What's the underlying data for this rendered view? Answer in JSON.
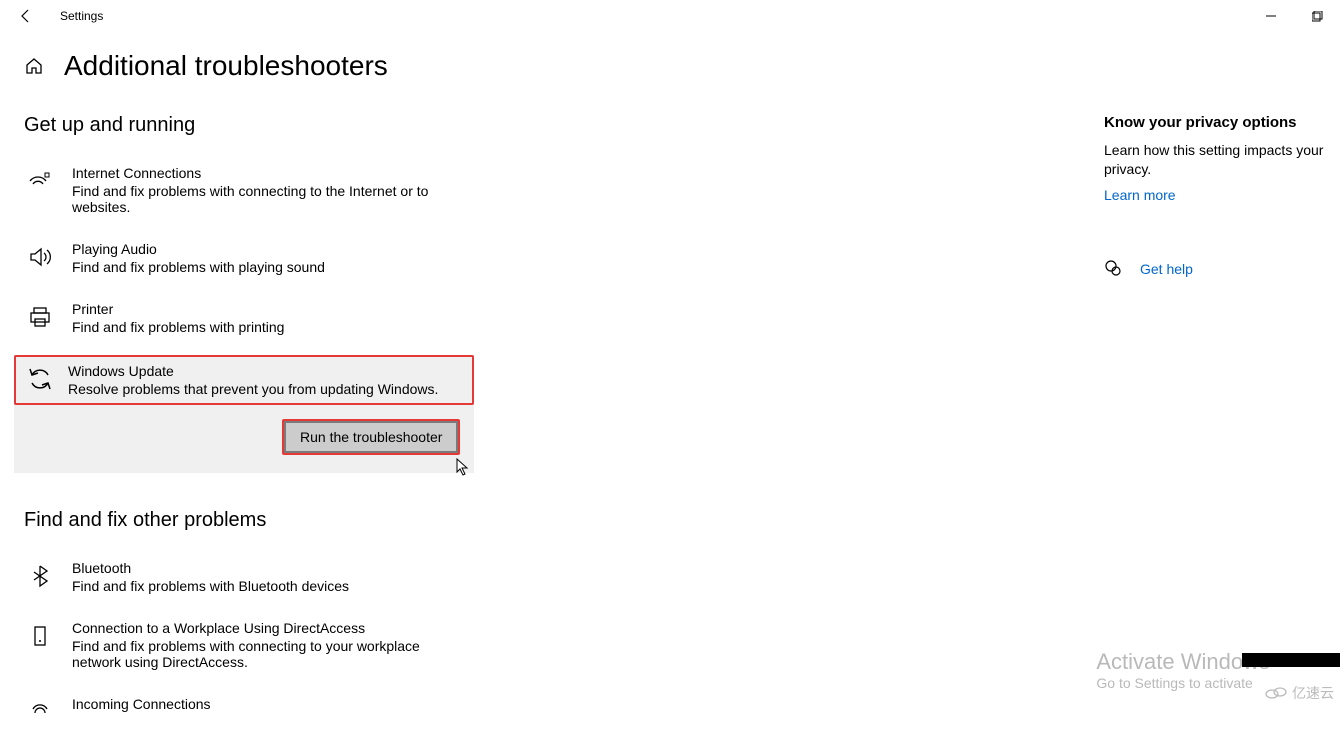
{
  "window": {
    "title": "Settings"
  },
  "page": {
    "title": "Additional troubleshooters"
  },
  "sections": {
    "getup": {
      "heading": "Get up and running",
      "items": [
        {
          "title": "Internet Connections",
          "desc": "Find and fix problems with connecting to the Internet or to websites."
        },
        {
          "title": "Playing Audio",
          "desc": "Find and fix problems with playing sound"
        },
        {
          "title": "Printer",
          "desc": "Find and fix problems with printing"
        },
        {
          "title": "Windows Update",
          "desc": "Resolve problems that prevent you from updating Windows.",
          "run_label": "Run the troubleshooter"
        }
      ]
    },
    "other": {
      "heading": "Find and fix other problems",
      "items": [
        {
          "title": "Bluetooth",
          "desc": "Find and fix problems with Bluetooth devices"
        },
        {
          "title": "Connection to a Workplace Using DirectAccess",
          "desc": "Find and fix problems with connecting to your workplace network using DirectAccess."
        },
        {
          "title": "Incoming Connections",
          "desc": ""
        }
      ]
    }
  },
  "sidebar": {
    "privacy_heading": "Know your privacy options",
    "privacy_desc": "Learn how this setting impacts your privacy.",
    "learn_more": "Learn more",
    "get_help": "Get help"
  },
  "watermark": {
    "line1": "Activate Windows",
    "line2": "Go to Settings to activate",
    "logo": "亿速云"
  }
}
